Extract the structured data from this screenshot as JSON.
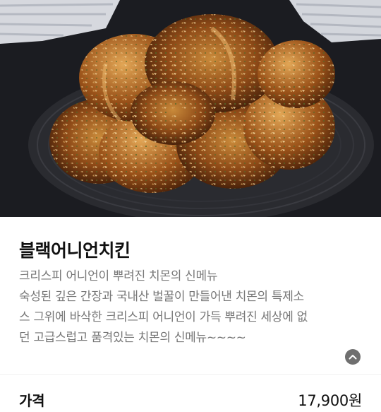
{
  "menu": {
    "name": "블랙어니언치킨",
    "description_lines": [
      "크리스피 어니언이 뿌려진 치몬의 신메뉴",
      "숙성된 깊은 간장과 국내산 벌꿀이 만들어낸 치몬의 특제소",
      "스 그위에 바삭한 크리스피 어니언이 가득 뿌려진 세상에 없",
      "던 고급스럽고 품격있는 치몬의 신메뉴~~~~"
    ],
    "price_label": "가격",
    "price_value": "17,900원"
  },
  "icons": {
    "collapse": "chevron-up-icon"
  },
  "colors": {
    "title": "#111111",
    "description": "#777777",
    "collapse_button": "#6f6f6f",
    "hero_background": "#1c1d22"
  }
}
